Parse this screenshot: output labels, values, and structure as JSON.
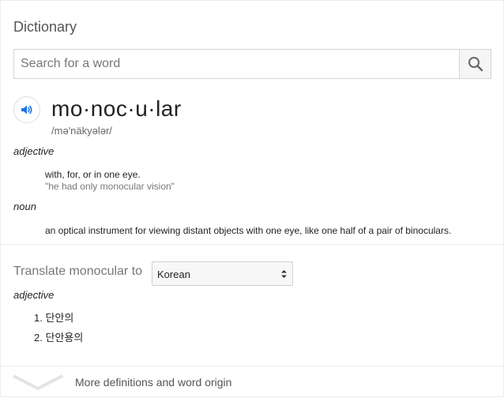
{
  "panel": {
    "title": "Dictionary"
  },
  "search": {
    "placeholder": "Search for a word",
    "value": ""
  },
  "entry": {
    "word": "mo·noc·u·lar",
    "phonetic": "/mə'näkyələr/",
    "senses": [
      {
        "part_of_speech": "adjective",
        "definition": "with, for, or in one eye.",
        "example": "\"he had only monocular vision\""
      },
      {
        "part_of_speech": "noun",
        "definition": "an optical instrument for viewing distant objects with one eye, like one half of a pair of binoculars."
      }
    ]
  },
  "translate": {
    "label": "Translate monocular to",
    "selected_language": "Korean",
    "part_of_speech": "adjective",
    "items": [
      "1. 단안의",
      "2. 단안용의"
    ]
  },
  "footer": {
    "more_label": "More definitions and word origin"
  },
  "icons": {
    "search": "search-icon",
    "speaker": "speaker-icon",
    "select_arrows": "select-arrows-icon",
    "expand": "chevron-down-icon"
  },
  "colors": {
    "accent_blue": "#1a73e8",
    "muted_text": "#777777"
  }
}
